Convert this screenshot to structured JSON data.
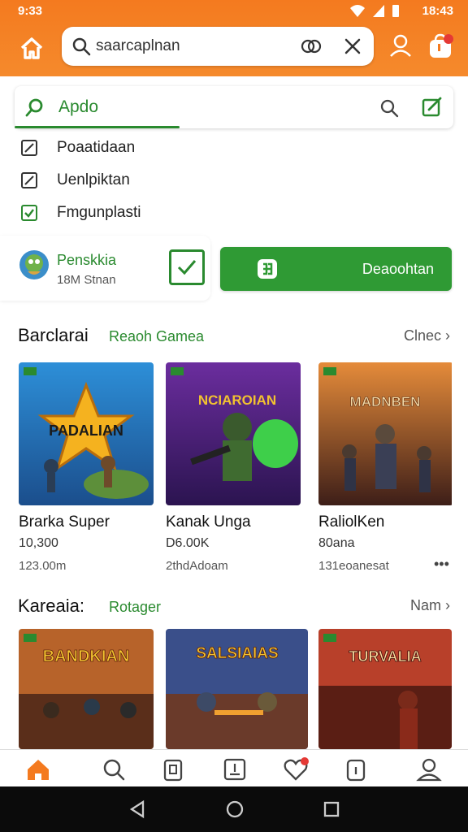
{
  "status": {
    "time_left": "9:33",
    "time_right": "18:43"
  },
  "search": {
    "query": "saarcaplnan"
  },
  "filter": {
    "label": "Apdo"
  },
  "checks": [
    {
      "label": "Poaatidaan",
      "checked": false
    },
    {
      "label": "Uenlpiktan",
      "checked": false
    },
    {
      "label": "Fmgunplasti",
      "checked": true
    }
  ],
  "promo": {
    "name": "Penskkia",
    "sub": "18M Stnan",
    "download_label": "Deaoohtan"
  },
  "section1": {
    "title": "Barclarai",
    "subtitle": "Reaoh Gamea",
    "more": "Clnec",
    "tiles": [
      {
        "title": "Brarka Super",
        "meta": "10,300",
        "meta2": "123.00m",
        "art_text": "PADALIAN"
      },
      {
        "title": "Kanak Unga",
        "meta": "D6.00K",
        "meta2": "2thdAdoam",
        "art_text": "NCIAROIAN"
      },
      {
        "title": "RaliolKen",
        "meta": "80ana",
        "meta2": "131eoanesat",
        "art_text": "MADNBEN"
      }
    ]
  },
  "section2": {
    "title": "Kareaia:",
    "subtitle": "Rotager",
    "more": "Nam",
    "tiles": [
      {
        "art_text": "BANDKIAN"
      },
      {
        "art_text": "SALSIAIAS"
      },
      {
        "art_text": "TURVALIA"
      }
    ]
  },
  "colors": {
    "accent_orange": "#f47a1f",
    "accent_green": "#2a8a2f"
  }
}
